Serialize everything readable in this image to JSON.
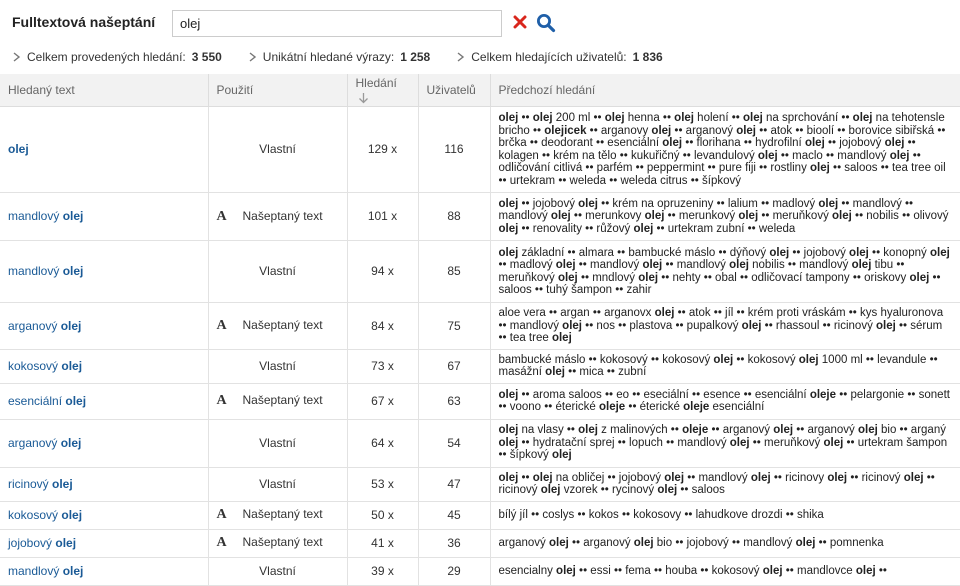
{
  "header": {
    "title": "Fulltextová našeptání",
    "search_value": "olej"
  },
  "stats": [
    {
      "label": "Celkem provedených hledání:",
      "value": "3 550"
    },
    {
      "label": "Unikátní hledané výrazy:",
      "value": "1 258"
    },
    {
      "label": "Celkem hledajících uživatelů:",
      "value": "1 836"
    }
  ],
  "table": {
    "columns": {
      "text": "Hledaný text",
      "use": "Použití",
      "count": "Hledání",
      "users": "Uživatelů",
      "previous": "Předchozí hledání"
    },
    "rows": [
      {
        "text": [
          "",
          "olej"
        ],
        "use_icon": false,
        "use": "Vlastní",
        "count": "129 x",
        "users": "116",
        "prev": [
          [
            "olej",
            1
          ],
          [
            " •• ",
            0
          ],
          [
            "olej",
            1
          ],
          [
            " 200 ml •• ",
            0
          ],
          [
            "olej",
            1
          ],
          [
            " henna •• ",
            0
          ],
          [
            "olej",
            1
          ],
          [
            " holení •• ",
            0
          ],
          [
            "olej",
            1
          ],
          [
            " na sprchování •• ",
            0
          ],
          [
            "olej",
            1
          ],
          [
            " na tehotensle bricho •• ",
            0
          ],
          [
            "olejicek",
            1
          ],
          [
            " •• arganovy ",
            0
          ],
          [
            "olej",
            1
          ],
          [
            " •• arganový ",
            0
          ],
          [
            "olej",
            1
          ],
          [
            " •• atok •• bioolí •• borovice sibiřská •• brčka •• deodorant •• esenciální ",
            0
          ],
          [
            "olej",
            1
          ],
          [
            " •• florihana •• hydrofilní ",
            0
          ],
          [
            "olej",
            1
          ],
          [
            " •• jojobový ",
            0
          ],
          [
            "olej",
            1
          ],
          [
            " •• kolagen •• krém na tělo •• kukuřičný •• levandulový ",
            0
          ],
          [
            "olej",
            1
          ],
          [
            " •• maclo •• mandlový ",
            0
          ],
          [
            "olej",
            1
          ],
          [
            " •• odličování citlivá •• parfém •• peppermint •• pure fiji •• rostliny ",
            0
          ],
          [
            "olej",
            1
          ],
          [
            " •• saloos •• tea tree oil •• urtekram •• weleda •• weleda citrus •• šípkový",
            0
          ]
        ]
      },
      {
        "text": [
          "mandlový ",
          "olej"
        ],
        "use_icon": true,
        "use": "Našeptaný text",
        "count": "101 x",
        "users": "88",
        "prev": [
          [
            "olej",
            1
          ],
          [
            " •• jojobový ",
            0
          ],
          [
            "olej",
            1
          ],
          [
            " •• krém na opruzeniny •• lalium •• madlový ",
            0
          ],
          [
            "olej",
            1
          ],
          [
            " •• mandlový •• mandlový ",
            0
          ],
          [
            "olej",
            1
          ],
          [
            " •• merunkovy ",
            0
          ],
          [
            "olej",
            1
          ],
          [
            " •• merunkový ",
            0
          ],
          [
            "olej",
            1
          ],
          [
            " •• meruňkový ",
            0
          ],
          [
            "olej",
            1
          ],
          [
            " •• nobilis •• olivový ",
            0
          ],
          [
            "olej",
            1
          ],
          [
            " •• renovality •• růžový ",
            0
          ],
          [
            "olej",
            1
          ],
          [
            " •• urtekram zubní •• weleda",
            0
          ]
        ]
      },
      {
        "text": [
          "mandlový ",
          "olej"
        ],
        "use_icon": false,
        "use": "Vlastní",
        "count": "94 x",
        "users": "85",
        "prev": [
          [
            "olej",
            1
          ],
          [
            " základní •• almara •• bambucké máslo •• dýňový ",
            0
          ],
          [
            "olej",
            1
          ],
          [
            " •• jojobový ",
            0
          ],
          [
            "olej",
            1
          ],
          [
            " •• konopný ",
            0
          ],
          [
            "olej",
            1
          ],
          [
            " •• madlový ",
            0
          ],
          [
            "olej",
            1
          ],
          [
            " •• mandlový ",
            0
          ],
          [
            "olej",
            1
          ],
          [
            " •• mandlový ",
            0
          ],
          [
            "olej",
            1
          ],
          [
            " nobilis •• mandlový ",
            0
          ],
          [
            "olej",
            1
          ],
          [
            " tibu •• meruňkový ",
            0
          ],
          [
            "olej",
            1
          ],
          [
            " •• mndlový ",
            0
          ],
          [
            "olej",
            1
          ],
          [
            " •• nehty •• obal •• odličovací tampony •• oriskovy ",
            0
          ],
          [
            "olej",
            1
          ],
          [
            " •• saloos •• tuhý šampon •• zahir",
            0
          ]
        ]
      },
      {
        "text": [
          "arganový ",
          "olej"
        ],
        "use_icon": true,
        "use": "Našeptaný text",
        "count": "84 x",
        "users": "75",
        "prev": [
          [
            "aloe vera •• argan •• arganovx ",
            0
          ],
          [
            "olej",
            1
          ],
          [
            " •• atok •• jíl •• krém proti vráskám •• kys hyaluronova •• mandlový ",
            0
          ],
          [
            "olej",
            1
          ],
          [
            " •• nos •• plastova •• pupalkový ",
            0
          ],
          [
            "olej",
            1
          ],
          [
            " •• rhassoul •• ricinový ",
            0
          ],
          [
            "olej",
            1
          ],
          [
            " •• sérum •• tea tree ",
            0
          ],
          [
            "olej",
            1
          ]
        ]
      },
      {
        "text": [
          "kokosový ",
          "olej"
        ],
        "use_icon": false,
        "use": "Vlastní",
        "count": "73 x",
        "users": "67",
        "prev": [
          [
            "bambucké máslo •• kokosový •• kokosový ",
            0
          ],
          [
            "olej",
            1
          ],
          [
            " •• kokosový ",
            0
          ],
          [
            "olej",
            1
          ],
          [
            " 1000 ml •• levandule •• masážní ",
            0
          ],
          [
            "olej",
            1
          ],
          [
            " •• mica •• zubní",
            0
          ]
        ]
      },
      {
        "text": [
          "esenciální ",
          "olej"
        ],
        "use_icon": true,
        "use": "Našeptaný text",
        "count": "67 x",
        "users": "63",
        "prev": [
          [
            "olej",
            1
          ],
          [
            " •• aroma saloos •• eo •• eseciální •• esence •• esenciální ",
            0
          ],
          [
            "oleje",
            1
          ],
          [
            " •• pelargonie •• sonett •• voono •• éterické ",
            0
          ],
          [
            "oleje",
            1
          ],
          [
            " •• éterické ",
            0
          ],
          [
            "oleje",
            1
          ],
          [
            " esenciální",
            0
          ]
        ]
      },
      {
        "text": [
          "arganový ",
          "olej"
        ],
        "use_icon": false,
        "use": "Vlastní",
        "count": "64 x",
        "users": "54",
        "prev": [
          [
            "olej",
            1
          ],
          [
            " na vlasy •• ",
            0
          ],
          [
            "olej",
            1
          ],
          [
            " z malinových •• ",
            0
          ],
          [
            "oleje",
            1
          ],
          [
            " •• arganový ",
            0
          ],
          [
            "olej",
            1
          ],
          [
            " •• arganový ",
            0
          ],
          [
            "olej",
            1
          ],
          [
            " bio •• arganý ",
            0
          ],
          [
            "olej",
            1
          ],
          [
            " •• hydratační sprej •• lopuch •• mandlový ",
            0
          ],
          [
            "olej",
            1
          ],
          [
            " •• meruňkový ",
            0
          ],
          [
            "olej",
            1
          ],
          [
            " •• urtekram šampon •• šípkový ",
            0
          ],
          [
            "olej",
            1
          ]
        ]
      },
      {
        "text": [
          "ricinový ",
          "olej"
        ],
        "use_icon": false,
        "use": "Vlastní",
        "count": "53 x",
        "users": "47",
        "prev": [
          [
            "olej",
            1
          ],
          [
            " •• ",
            0
          ],
          [
            "olej",
            1
          ],
          [
            " na obličej •• jojobový ",
            0
          ],
          [
            "olej",
            1
          ],
          [
            " •• mandlový ",
            0
          ],
          [
            "olej",
            1
          ],
          [
            " •• ricinovy ",
            0
          ],
          [
            "olej",
            1
          ],
          [
            " •• ricinový ",
            0
          ],
          [
            "olej",
            1
          ],
          [
            " •• ricinový ",
            0
          ],
          [
            "olej",
            1
          ],
          [
            " vzorek •• rycinový ",
            0
          ],
          [
            "olej",
            1
          ],
          [
            " •• saloos",
            0
          ]
        ]
      },
      {
        "text": [
          "kokosový ",
          "olej"
        ],
        "use_icon": true,
        "use": "Našeptaný text",
        "count": "50 x",
        "users": "45",
        "prev": [
          [
            "bílý jíl •• coslys •• kokos •• kokosovy •• lahudkove drozdi •• shika",
            0
          ]
        ]
      },
      {
        "text": [
          "jojobový ",
          "olej"
        ],
        "use_icon": true,
        "use": "Našeptaný text",
        "count": "41 x",
        "users": "36",
        "prev": [
          [
            "arganový ",
            0
          ],
          [
            "olej",
            1
          ],
          [
            " •• arganový ",
            0
          ],
          [
            "olej",
            1
          ],
          [
            " bio •• jojobový •• mandlový ",
            0
          ],
          [
            "olej",
            1
          ],
          [
            " •• pomnenka",
            0
          ]
        ]
      },
      {
        "text": [
          "mandlový ",
          "olej"
        ],
        "use_icon": false,
        "use": "Vlastní",
        "count": "39 x",
        "users": "29",
        "prev": [
          [
            "esencialny ",
            0
          ],
          [
            "olej",
            1
          ],
          [
            " •• essi •• fema •• houba •• kokosový ",
            0
          ],
          [
            "olej",
            1
          ],
          [
            " •• mandlovce ",
            0
          ],
          [
            "olej",
            1
          ],
          [
            " ••",
            0
          ]
        ]
      }
    ]
  }
}
